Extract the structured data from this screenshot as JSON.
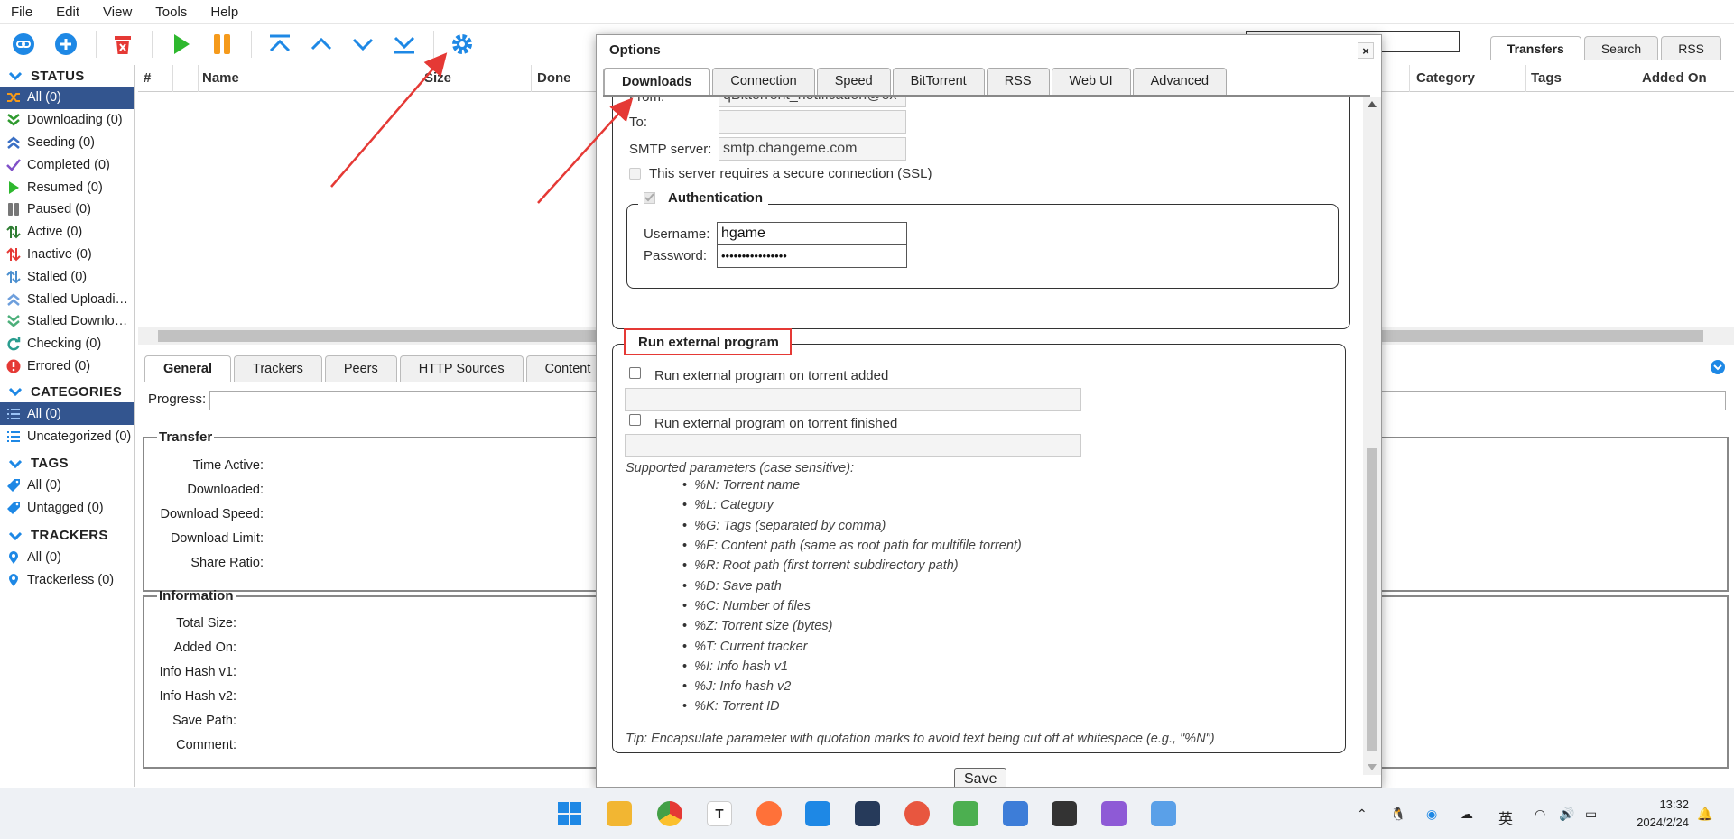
{
  "menu": [
    "File",
    "Edit",
    "View",
    "Tools",
    "Help"
  ],
  "right_tabs": [
    "Transfers",
    "Search",
    "RSS"
  ],
  "sidebar": {
    "status_title": "STATUS",
    "status": [
      "All (0)",
      "Downloading (0)",
      "Seeding (0)",
      "Completed (0)",
      "Resumed (0)",
      "Paused (0)",
      "Active (0)",
      "Inactive (0)",
      "Stalled (0)",
      "Stalled Uploadi…",
      "Stalled Downlo…",
      "Checking (0)",
      "Errored (0)"
    ],
    "categories_title": "CATEGORIES",
    "categories": [
      "All (0)",
      "Uncategorized (0)"
    ],
    "tags_title": "TAGS",
    "tags": [
      "All (0)",
      "Untagged (0)"
    ],
    "trackers_title": "TRACKERS",
    "trackers": [
      "All (0)",
      "Trackerless (0)"
    ]
  },
  "table": {
    "col_hash": "#",
    "col_name": "Name",
    "col_size": "Size",
    "col_done": "Done",
    "col_category": "Category",
    "col_tags": "Tags",
    "col_added": "Added On"
  },
  "panel": {
    "tabs": [
      "General",
      "Trackers",
      "Peers",
      "HTTP Sources",
      "Content"
    ],
    "progress_label": "Progress:",
    "transfer_title": "Transfer",
    "transfer": [
      "Time Active:",
      "Downloaded:",
      "Download Speed:",
      "Download Limit:",
      "Share Ratio:"
    ],
    "info_title": "Information",
    "info": [
      "Total Size:",
      "Added On:",
      "Info Hash v1:",
      "Info Hash v2:",
      "Save Path:",
      "Comment:"
    ]
  },
  "options": {
    "title": "Options",
    "close": "×",
    "tabs": [
      "Downloads",
      "Connection",
      "Speed",
      "BitTorrent",
      "RSS",
      "Web UI",
      "Advanced"
    ],
    "from_label": "From:",
    "from_value": "qBittorrent_notification@ex",
    "to_label": "To:",
    "to_value": "",
    "smtp_label": "SMTP server:",
    "smtp_value": "smtp.changeme.com",
    "ssl_label": "This server requires a secure connection (SSL)",
    "auth_title": "Authentication",
    "username_label": "Username:",
    "username_value": "hgame",
    "password_label": "Password:",
    "password_value": "••••••••••••••••",
    "run_title": "Run external program",
    "run_added": "Run external program on torrent added",
    "run_finished": "Run external program on torrent finished",
    "supported": "Supported parameters (case sensitive):",
    "params": [
      "%N: Torrent name",
      "%L: Category",
      "%G: Tags (separated by comma)",
      "%F: Content path (same as root path for multifile torrent)",
      "%R: Root path (first torrent subdirectory path)",
      "%D: Save path",
      "%C: Number of files",
      "%Z: Torrent size (bytes)",
      "%T: Current tracker",
      "%I: Info hash v1",
      "%J: Info hash v2",
      "%K: Torrent ID"
    ],
    "tip": "Tip: Encapsulate parameter with quotation marks to avoid text being cut off at whitespace (e.g., \"%N\")",
    "save": "Save"
  },
  "taskbar": {
    "ime": "英",
    "time": "13:32",
    "date": "2024/2/24"
  },
  "colors": {
    "accent": "#33558f",
    "highlight": "#e53935",
    "blue": "#1e88e5"
  }
}
